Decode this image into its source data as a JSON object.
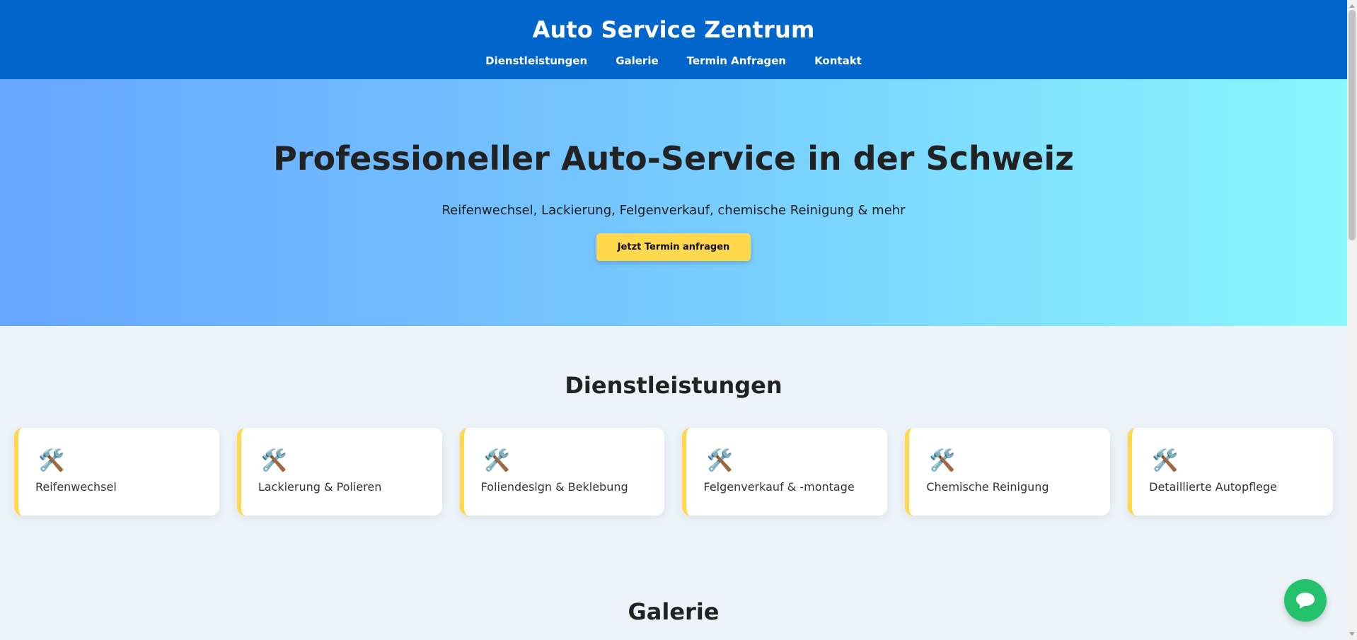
{
  "header": {
    "title": "Auto Service Zentrum",
    "nav": [
      "Dienstleistungen",
      "Galerie",
      "Termin Anfragen",
      "Kontakt"
    ]
  },
  "hero": {
    "heading": "Professioneller Auto-Service in der Schweiz",
    "subtitle": "Reifenwechsel, Lackierung, Felgenverkauf, chemische Reinigung & mehr",
    "cta_label": "Jetzt Termin anfragen"
  },
  "services": {
    "title": "Dienstleistungen",
    "icon": "🛠️",
    "icon_name": "tools-icon",
    "items": [
      "Reifenwechsel",
      "Lackierung & Polieren",
      "Foliendesign & Beklebung",
      "Felgenverkauf & -montage",
      "Chemische Reinigung",
      "Detaillierte Autopflege"
    ]
  },
  "gallery": {
    "title": "Galerie"
  },
  "colors": {
    "header": "#0066cc",
    "accent": "#ffd84d",
    "chat": "#25c26e"
  }
}
